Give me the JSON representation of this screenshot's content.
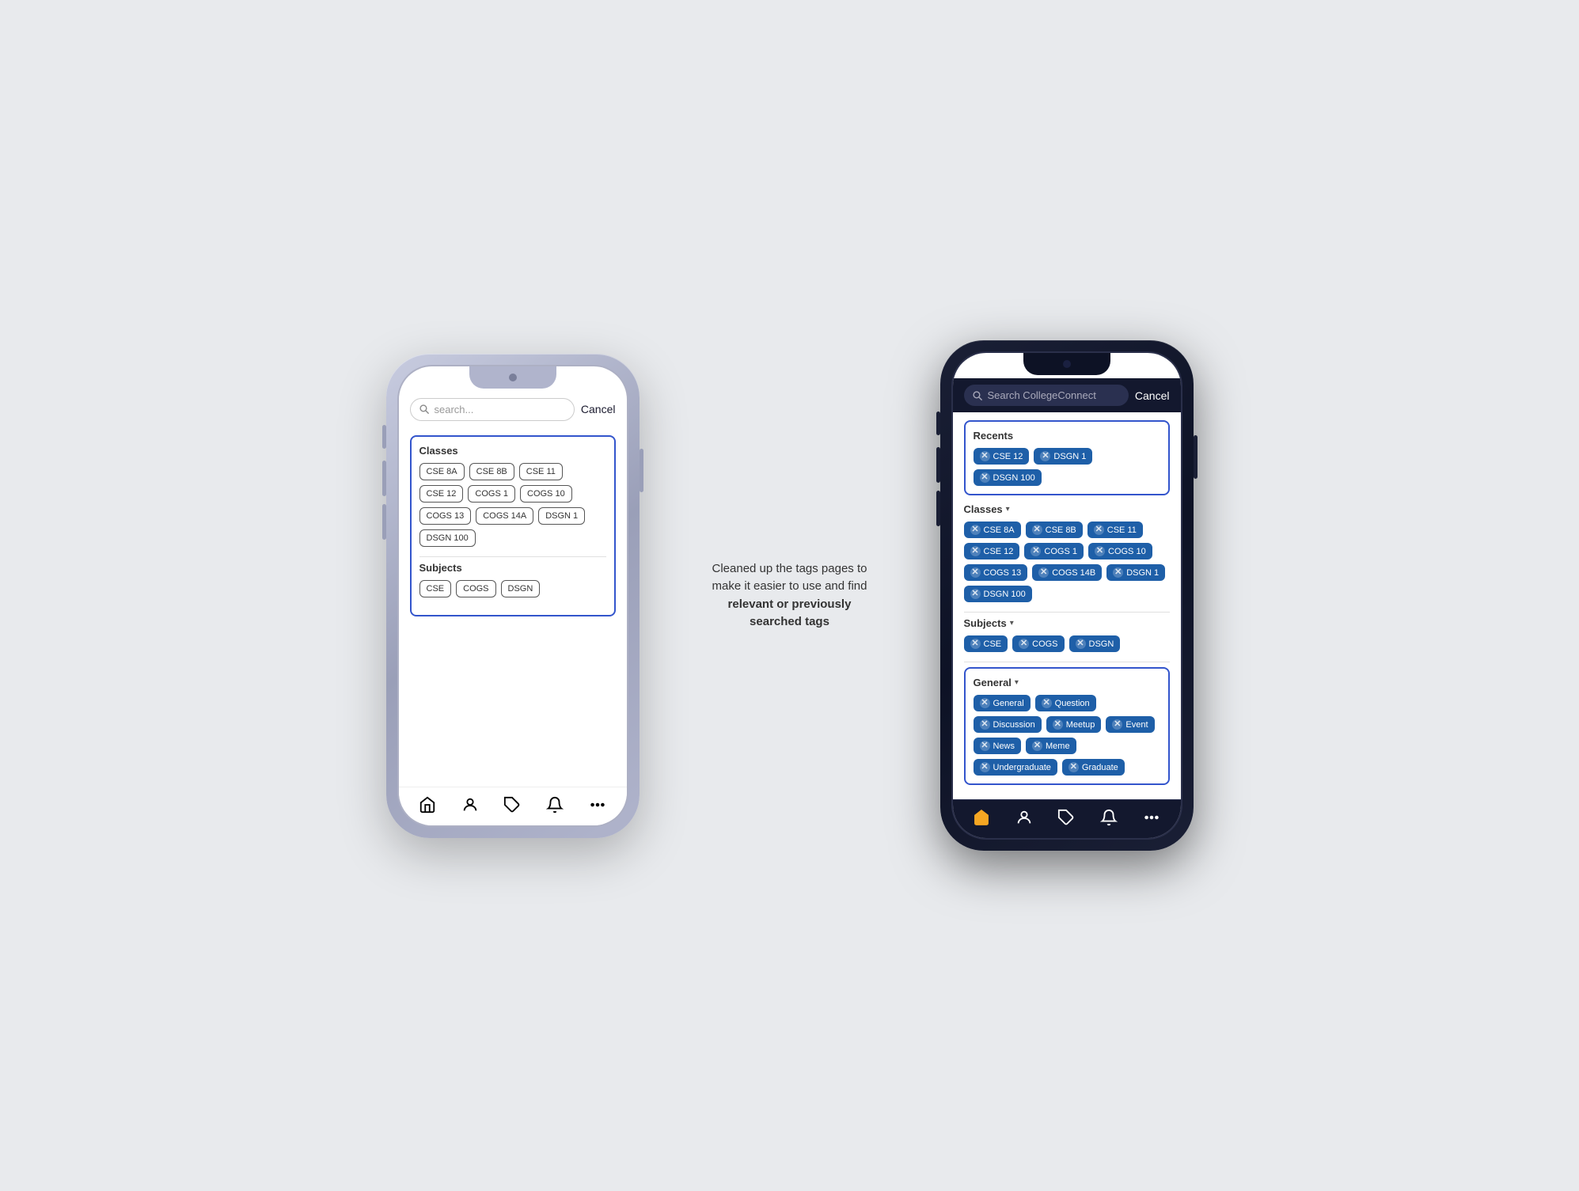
{
  "left_phone": {
    "search_placeholder": "search...",
    "cancel_label": "Cancel",
    "classes_section": {
      "title": "Classes",
      "tags": [
        "CSE 8A",
        "CSE 8B",
        "CSE 11",
        "CSE 12",
        "COGS 1",
        "COGS 10",
        "COGS 13",
        "COGS 14A",
        "DSGN 1",
        "DSGN 100"
      ]
    },
    "subjects_section": {
      "title": "Subjects",
      "tags": [
        "CSE",
        "COGS",
        "DSGN"
      ]
    },
    "nav_icons": [
      "home",
      "person",
      "tag",
      "bell",
      "more"
    ]
  },
  "right_phone": {
    "search_placeholder": "Search CollegeConnect",
    "cancel_label": "Cancel",
    "recents_section": {
      "title": "Recents",
      "tags": [
        "CSE 12",
        "DSGN 1",
        "DSGN 100"
      ]
    },
    "classes_section": {
      "title": "Classes",
      "tags": [
        "CSE 8A",
        "CSE 8B",
        "CSE 11",
        "CSE 12",
        "COGS 1",
        "COGS 10",
        "COGS 13",
        "COGS 14B",
        "DSGN 1",
        "DSGN 100"
      ]
    },
    "subjects_section": {
      "title": "Subjects",
      "tags": [
        "CSE",
        "COGS",
        "DSGN"
      ]
    },
    "general_section": {
      "title": "General",
      "tags": [
        "General",
        "Question",
        "Discussion",
        "Meetup",
        "Event",
        "News",
        "Meme",
        "Undergraduate",
        "Graduate"
      ]
    },
    "nav_icons": [
      "home",
      "person",
      "tag",
      "bell",
      "more"
    ]
  },
  "annotation": {
    "text_normal": "Cleaned up the tags pages to make it easier to use and find ",
    "text_bold": "relevant or previously searched tags"
  }
}
